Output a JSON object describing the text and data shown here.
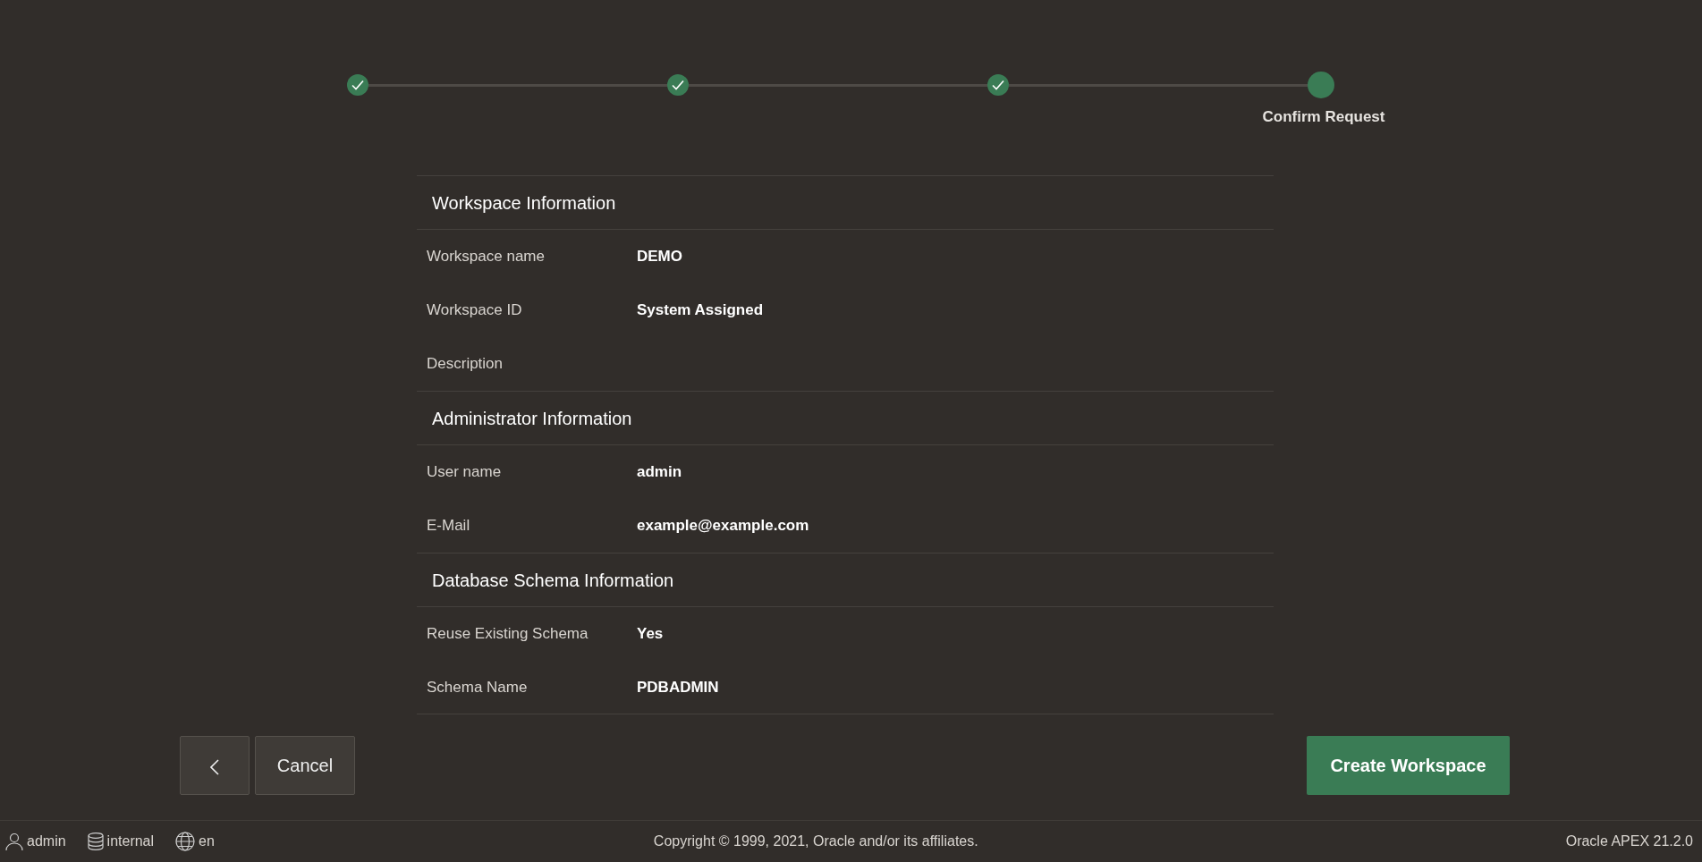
{
  "wizard_steps": [
    {
      "done": true,
      "selected": false
    },
    {
      "done": true,
      "selected": false
    },
    {
      "done": true,
      "selected": false
    },
    {
      "label": "Confirm Request",
      "done": false,
      "selected": true
    }
  ],
  "sections": [
    {
      "title": "Workspace Information",
      "rows": [
        {
          "label": "Workspace name",
          "value": "DEMO"
        },
        {
          "label": "Workspace ID",
          "value": "System Assigned"
        },
        {
          "label": "Description"
        }
      ]
    },
    {
      "title": "Administrator Information",
      "rows": [
        {
          "label": "User name",
          "value": "admin"
        },
        {
          "label": "E-Mail",
          "value": "example@example.com"
        }
      ]
    },
    {
      "title": "Database Schema Information",
      "rows": [
        {
          "label": "Reuse Existing Schema",
          "value": "Yes"
        },
        {
          "label": "Schema Name",
          "value": "PDBADMIN"
        }
      ]
    }
  ],
  "buttons": {
    "cancel": "Cancel",
    "create": "Create Workspace"
  },
  "footer": {
    "user": "admin",
    "schema": "internal",
    "language": "en",
    "copyright": "Copyright © 1999, 2021, Oracle and/or its affiliates.",
    "version": "Oracle APEX 21.2.0"
  }
}
